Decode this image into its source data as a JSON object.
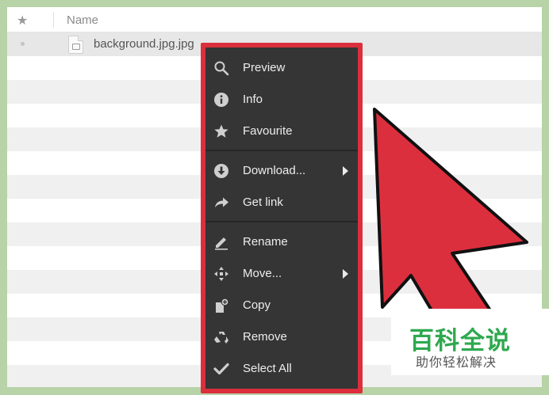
{
  "header": {
    "star_label": "★",
    "name_label": "Name"
  },
  "file": {
    "name": "background.jpg.jpg"
  },
  "context_menu": {
    "items": [
      {
        "label": "Preview",
        "icon": "search-icon"
      },
      {
        "label": "Info",
        "icon": "info-icon"
      },
      {
        "label": "Favourite",
        "icon": "star-icon"
      },
      {
        "label": "Download...",
        "icon": "download-icon",
        "submenu": true
      },
      {
        "label": "Get link",
        "icon": "share-arrow-icon"
      },
      {
        "label": "Rename",
        "icon": "pencil-icon"
      },
      {
        "label": "Move...",
        "icon": "move-icon",
        "submenu": true
      },
      {
        "label": "Copy",
        "icon": "copy-icon"
      },
      {
        "label": "Remove",
        "icon": "recycle-icon"
      },
      {
        "label": "Select All",
        "icon": "checkmark-icon"
      }
    ]
  },
  "watermark": {
    "title": "百科全说",
    "subtitle": "助你轻松解决"
  },
  "colors": {
    "highlight_red": "#dc2f3d",
    "menu_background": "#353535",
    "page_border_green": "#b7d3a7",
    "watermark_green": "#2fa84f"
  }
}
